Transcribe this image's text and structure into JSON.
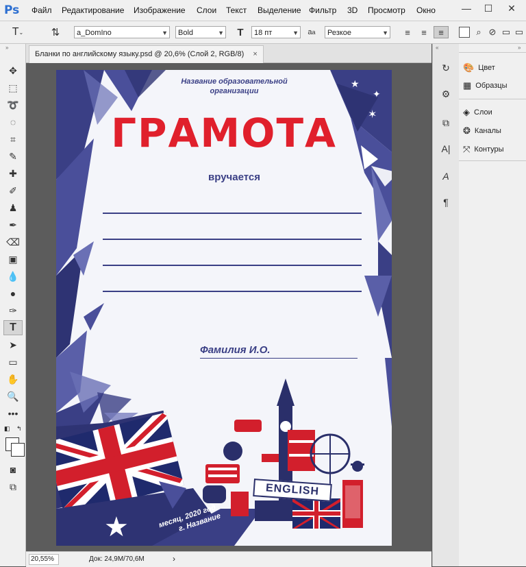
{
  "app": {
    "logo": "Ps"
  },
  "menubar": {
    "items": [
      "Файл",
      "Редактирование",
      "Изображение",
      "Слои",
      "Текст",
      "Выделение",
      "Фильтр",
      "3D",
      "Просмотр",
      "Окно"
    ],
    "window_buttons": [
      "—",
      "☐",
      "✕"
    ]
  },
  "options": {
    "font_family": "a_DomIno",
    "font_style": "Bold",
    "font_size": "18 пт",
    "aa_label": "a",
    "antialias": "Резкое",
    "icons": [
      "text-tool-icon",
      "text-orientation-icon",
      "font-size-icon",
      "antialias-icon",
      "align-left-icon",
      "align-center-icon",
      "align-right-icon"
    ]
  },
  "tools": {
    "active": "type-tool",
    "names": [
      "move-tool",
      "marquee-tool",
      "lasso-tool",
      "quick-select-tool",
      "crop-tool",
      "eyedropper-tool",
      "healing-brush-tool",
      "brush-tool",
      "clone-stamp-tool",
      "history-brush-tool",
      "eraser-tool",
      "gradient-tool",
      "blur-tool",
      "dodge-tool",
      "pen-tool",
      "type-tool",
      "path-select-tool",
      "rectangle-tool",
      "hand-tool",
      "zoom-tool",
      "more-tools"
    ]
  },
  "document": {
    "tab_title": "Бланки по английскому языку.psd @ 20,6% (Слой 2, RGB/8)",
    "close": "×"
  },
  "status": {
    "zoom": "20,55%",
    "doc_info": "Док: 24,9M/70,6M",
    "arrow": "›"
  },
  "panels": {
    "group1": [
      {
        "label": "Цвет",
        "icon": "color-palette-icon"
      },
      {
        "label": "Образцы",
        "icon": "swatches-grid-icon"
      }
    ],
    "group2": [
      {
        "label": "Слои",
        "icon": "layers-icon"
      },
      {
        "label": "Каналы",
        "icon": "channels-icon"
      },
      {
        "label": "Контуры",
        "icon": "paths-icon"
      }
    ],
    "strip_icons": [
      "history-icon",
      "properties-icon",
      "libraries-icon",
      "character-icon",
      "paragraph-style-icon",
      "paragraph-icon"
    ]
  },
  "certificate": {
    "org_name": "Название образовательной организации",
    "title": "ГРАМОТА",
    "awarded": "вручается",
    "surname": "Фамилия И.О.",
    "date_line1": "месяц, 2020 год",
    "date_line2": "г. Название",
    "english_sign": "ENGLISH",
    "colors": {
      "navy": "#3a3f85",
      "red": "#e0202c",
      "paper": "#f4f5fa"
    }
  }
}
